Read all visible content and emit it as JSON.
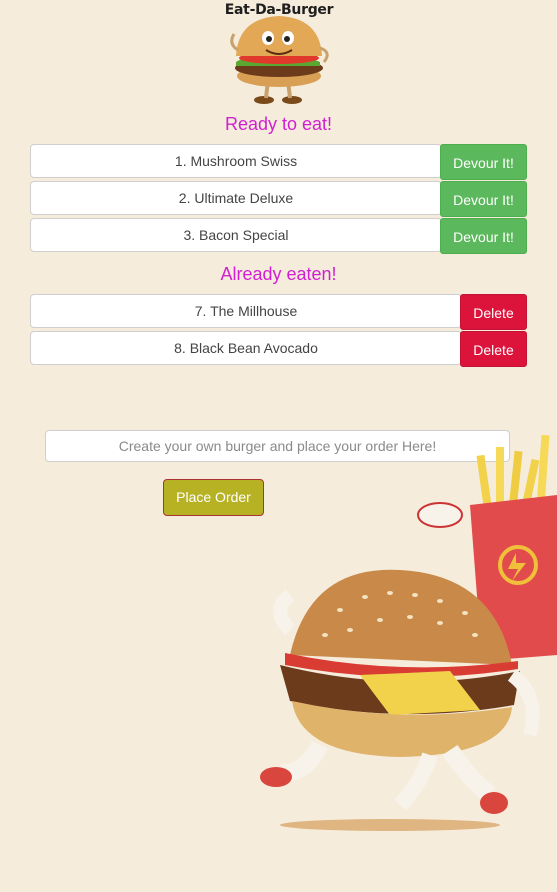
{
  "app": {
    "logo_text": "Eat-Da-Burger"
  },
  "ready": {
    "title": "Ready to eat!",
    "button_label": "Devour It!",
    "items": [
      {
        "label": "1. Mushroom Swiss"
      },
      {
        "label": "2. Ultimate Deluxe"
      },
      {
        "label": "3. Bacon Special"
      }
    ]
  },
  "eaten": {
    "title": "Already eaten!",
    "button_label": "Delete",
    "items": [
      {
        "label": "7. The Millhouse"
      },
      {
        "label": "8. Black Bean Avocado"
      }
    ]
  },
  "order": {
    "placeholder": "Create your own burger and place your order Here!",
    "value": "",
    "button_label": "Place Order"
  },
  "colors": {
    "background": "#f5ecdc",
    "title": "#d11fd1",
    "devour": "#5cb85c",
    "delete": "#dc143c",
    "place_order": "#b7b224"
  }
}
